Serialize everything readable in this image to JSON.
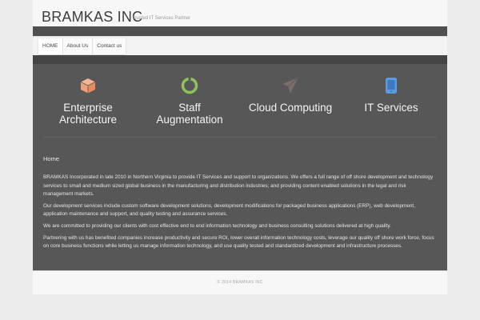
{
  "header": {
    "logo": "BRAMKAS INC",
    "tagline": "Trusted IT Services Partner"
  },
  "nav": {
    "items": [
      {
        "label": "HOME"
      },
      {
        "label": "About Us"
      },
      {
        "label": "Contact us"
      }
    ]
  },
  "services": [
    {
      "title_line1": "Enterprise",
      "title_line2": "Architecture",
      "icon": "cube-icon",
      "color": "#f1a07a"
    },
    {
      "title_line1": "Staff",
      "title_line2": "Augmentation",
      "icon": "circle-spinner-icon",
      "color": "#8fc25a"
    },
    {
      "title_line1": "Cloud Computing",
      "title_line2": "",
      "icon": "paper-plane-icon",
      "color": "#7b6e6a"
    },
    {
      "title_line1": "IT Services",
      "title_line2": "",
      "icon": "mobile-device-icon",
      "color": "#5b9be0"
    }
  ],
  "main": {
    "heading": "Home",
    "paragraphs": [
      "BRAMKAS Incorporated in late 2010 in Northern Virginia to provide  IT Services and support to organizations. We offers a full range of off shore development and technology services to small and medium sized global business in the manufacturing and distribution industries; and providing content enabled solutions in the legal and risk management markets.",
      "Our development services include custom software development solutions, development modifications for packaged business applications (ERP), web development, application maintenance and support, and quality testing and assurance services.",
      "We are committed to providing our clients with cost effective end to end information technology and business consulting solutions delivered at high quality.",
      "Partnering with us has benefited companies increase productivity and secure ROI, lower overall information technology costs, leverage our quality off shore work force, focus on core business functions while letting us manage information technology, and use quality tested and standardized development and infrastructure processes."
    ]
  },
  "footer": {
    "copyright": "© 2014 BRAMKAS INC"
  },
  "colors": {
    "main_bg": "#575757",
    "dark_bar": "#4f4f4f",
    "header_bg": "#f7f7f7"
  }
}
